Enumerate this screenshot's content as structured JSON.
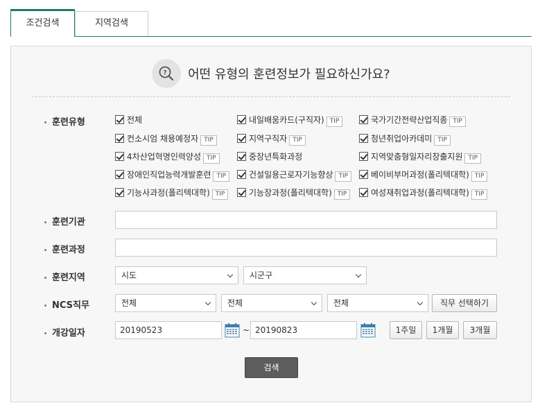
{
  "tabs": [
    {
      "label": "조건검색",
      "active": true
    },
    {
      "label": "지역검색",
      "active": false
    }
  ],
  "question": "어떤 유형의 훈련정보가 필요하신가요?",
  "labels": {
    "type": "훈련유형",
    "institution": "훈련기관",
    "course": "훈련과정",
    "region": "훈련지역",
    "ncs": "NCS직무",
    "date": "개강일자"
  },
  "tip_label": "TIP",
  "training_types": [
    {
      "label": "전체",
      "checked": true,
      "tip": false
    },
    {
      "label": "내일배움카드(구직자)",
      "checked": true,
      "tip": true
    },
    {
      "label": "국가기간전략산업직종",
      "checked": true,
      "tip": true
    },
    {
      "label": "컨소시엄 채용예정자",
      "checked": true,
      "tip": true
    },
    {
      "label": "지역구직자",
      "checked": true,
      "tip": true
    },
    {
      "label": "청년취업아카데미",
      "checked": true,
      "tip": true
    },
    {
      "label": "4차산업혁명인력양성",
      "checked": true,
      "tip": true
    },
    {
      "label": "중장년특화과정",
      "checked": true,
      "tip": false
    },
    {
      "label": "지역맞춤형일자리창출지원",
      "checked": true,
      "tip": true
    },
    {
      "label": "장애인직업능력개발훈련",
      "checked": true,
      "tip": true
    },
    {
      "label": "건설일용근로자기능향상",
      "checked": true,
      "tip": true
    },
    {
      "label": "베이비부머과정(폴리텍대학)",
      "checked": true,
      "tip": true
    },
    {
      "label": "기능사과정(폴리텍대학)",
      "checked": true,
      "tip": true
    },
    {
      "label": "기능장과정(폴리텍대학)",
      "checked": true,
      "tip": true
    },
    {
      "label": "여성재취업과정(폴리텍대학)",
      "checked": true,
      "tip": true
    }
  ],
  "institution_value": "",
  "course_value": "",
  "region": {
    "sido": "시도",
    "sigungu": "시군구"
  },
  "ncs": {
    "level1": "전체",
    "level2": "전체",
    "level3": "전체",
    "button": "직무 선택하기"
  },
  "date": {
    "start": "20190523",
    "separator": "~",
    "end": "20190823",
    "week1": "1주일",
    "month1": "1개월",
    "month3": "3개월"
  },
  "search_button": "검색"
}
